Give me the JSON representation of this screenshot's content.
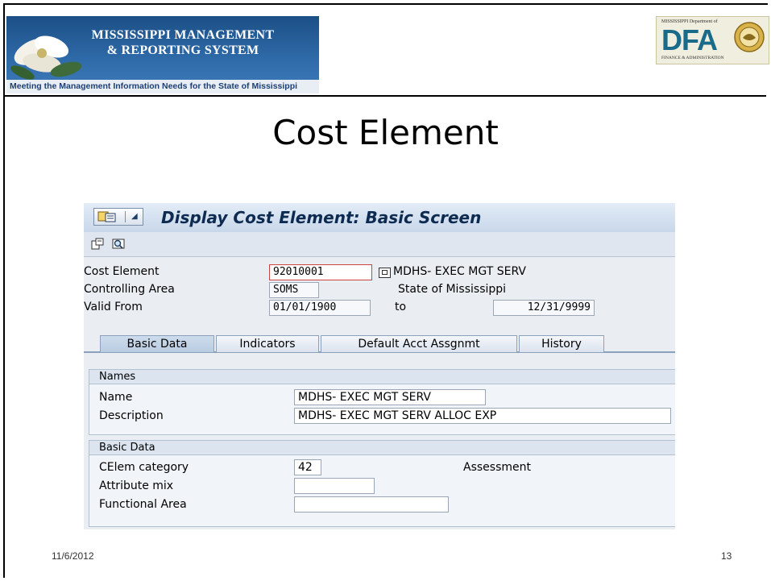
{
  "header": {
    "banner_line1": "MISSISSIPPI MANAGEMENT",
    "banner_line2": "& REPORTING SYSTEM",
    "banner_tagline": "Meeting the Management Information Needs for the State of Mississippi",
    "dfa_top": "MISSISSIPPI Department of",
    "dfa_letters": "DFA",
    "dfa_bottom": "FINANCE & ADMINISTRATION"
  },
  "slide": {
    "title": "Cost Element",
    "date": "11/6/2012",
    "page_number": "13"
  },
  "sap": {
    "window_title": "Display Cost Element: Basic Screen",
    "toolbar_icons": [
      "change-display-icon",
      "find-icon"
    ],
    "fields": {
      "cost_element_label": "Cost Element",
      "cost_element_value": "92010001",
      "cost_element_text": "MDHS- EXEC MGT SERV",
      "controlling_area_label": "Controlling Area",
      "controlling_area_value": "SOMS",
      "controlling_area_text": "State of Mississippi",
      "valid_from_label": "Valid From",
      "valid_from_value": "01/01/1900",
      "valid_to_label": "to",
      "valid_to_value": "12/31/9999"
    },
    "tabs": [
      "Basic Data",
      "Indicators",
      "Default Acct Assgnmt",
      "History"
    ],
    "active_tab": "Basic Data",
    "names_group": {
      "title": "Names",
      "name_label": "Name",
      "name_value": "MDHS- EXEC MGT SERV",
      "description_label": "Description",
      "description_value": "MDHS- EXEC MGT SERV ALLOC EXP"
    },
    "basic_group": {
      "title": "Basic Data",
      "category_label": "CElem category",
      "category_value": "42",
      "category_text": "Assessment",
      "attribute_label": "Attribute mix",
      "attribute_value": "",
      "functional_label": "Functional Area",
      "functional_value": ""
    }
  },
  "colors": {
    "banner_blue": "#1c4f86",
    "dfa_teal": "#1a6b8a",
    "sap_title": "#0d2a50"
  }
}
